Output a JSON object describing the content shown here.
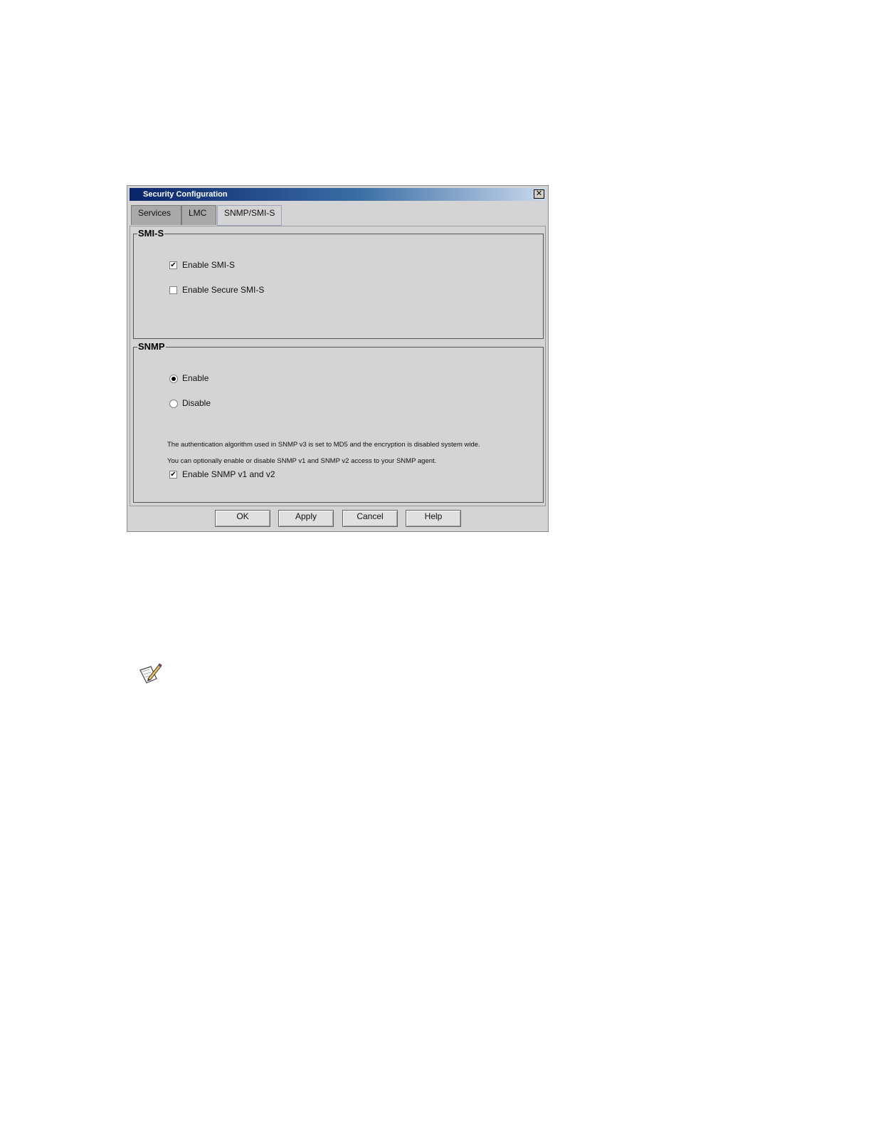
{
  "window": {
    "title": "Security Configuration",
    "close_glyph": "✕"
  },
  "tabs": [
    {
      "label": "Services",
      "active": false
    },
    {
      "label": "LMC",
      "active": false
    },
    {
      "label": "SNMP/SMI-S",
      "active": true
    }
  ],
  "smis": {
    "group_title": "SMI-S",
    "enable_smis": {
      "label": "Enable SMI-S",
      "checked": true
    },
    "enable_secure_smis": {
      "label": "Enable Secure SMI-S",
      "checked": false
    }
  },
  "snmp": {
    "group_title": "SNMP",
    "enable": {
      "label": "Enable",
      "selected": true
    },
    "disable": {
      "label": "Disable",
      "selected": false
    },
    "info_line1": "The authentication algorithm used in SNMP v3 is set to MD5 and the encryption is disabled system wide.",
    "info_line2": "You can optionally enable or disable SNMP v1 and SNMP v2 access to your SNMP agent.",
    "enable_v1v2": {
      "label": "Enable SNMP v1 and v2",
      "checked": true
    }
  },
  "buttons": {
    "ok": "OK",
    "apply": "Apply",
    "cancel": "Cancel",
    "help": "Help"
  },
  "check_glyph": "✔",
  "icons": {
    "note": "note-pencil-icon"
  },
  "colors": {
    "titlebar_start": "#0a246a",
    "titlebar_end": "#c8d8ec",
    "dialog_bg": "#d4d4d4"
  }
}
